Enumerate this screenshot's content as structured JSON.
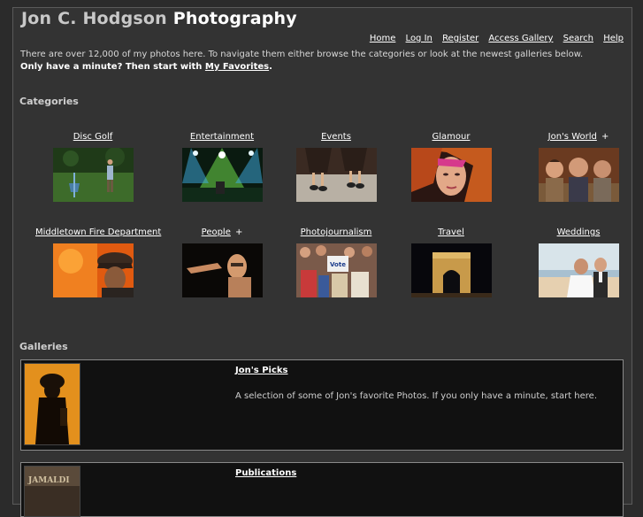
{
  "header": {
    "title_part1": "Jon C. Hodgson",
    "title_part2": "Photography"
  },
  "nav": [
    "Home",
    "Log In",
    "Register",
    "Access Gallery",
    "Search",
    "Help"
  ],
  "intro": {
    "line1": "There are over 12,000 of my photos here. To navigate them either browse the categories or look at the newest galleries below.",
    "line2_prefix": "Only have a minute? Then start with ",
    "line2_link": "My Favorites",
    "line2_suffix": "."
  },
  "categories_title": "Categories",
  "categories": [
    {
      "label": "Disc Golf",
      "plus": ""
    },
    {
      "label": "Entertainment",
      "plus": ""
    },
    {
      "label": "Events",
      "plus": ""
    },
    {
      "label": "Glamour",
      "plus": ""
    },
    {
      "label": "Jon's World",
      "plus": "+"
    },
    {
      "label": "Middletown Fire Department",
      "plus": ""
    },
    {
      "label": "People",
      "plus": "+"
    },
    {
      "label": "Photojournalism",
      "plus": ""
    },
    {
      "label": "Travel",
      "plus": ""
    },
    {
      "label": "Weddings",
      "plus": ""
    }
  ],
  "galleries_title": "Galleries",
  "galleries": [
    {
      "title": "Jon's Picks",
      "description": "A selection of some of Jon's favorite Photos. If you only have a minute, start here."
    },
    {
      "title": "Publications",
      "description": ""
    }
  ],
  "colors": {
    "background": "#2b2b2b",
    "panel": "#333333",
    "gallery_box": "#111111"
  }
}
